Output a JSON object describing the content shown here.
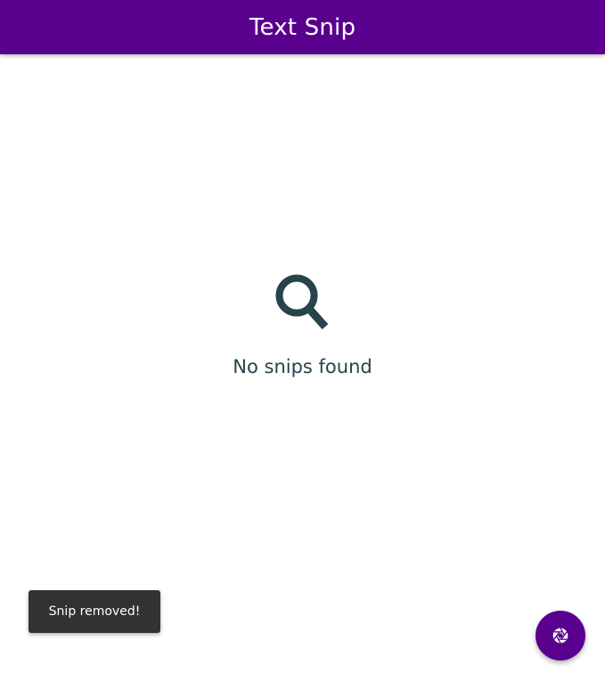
{
  "app_bar": {
    "title": "Text Snip"
  },
  "empty_state": {
    "icon": "search-icon",
    "message": "No snips found"
  },
  "snackbar": {
    "message": "Snip removed!"
  },
  "fab": {
    "icon": "camera-shutter-icon"
  },
  "colors": {
    "primary": "#5a008f",
    "empty_state_text": "#28434a",
    "snackbar_background": "#323232",
    "background": "#ffffff"
  }
}
